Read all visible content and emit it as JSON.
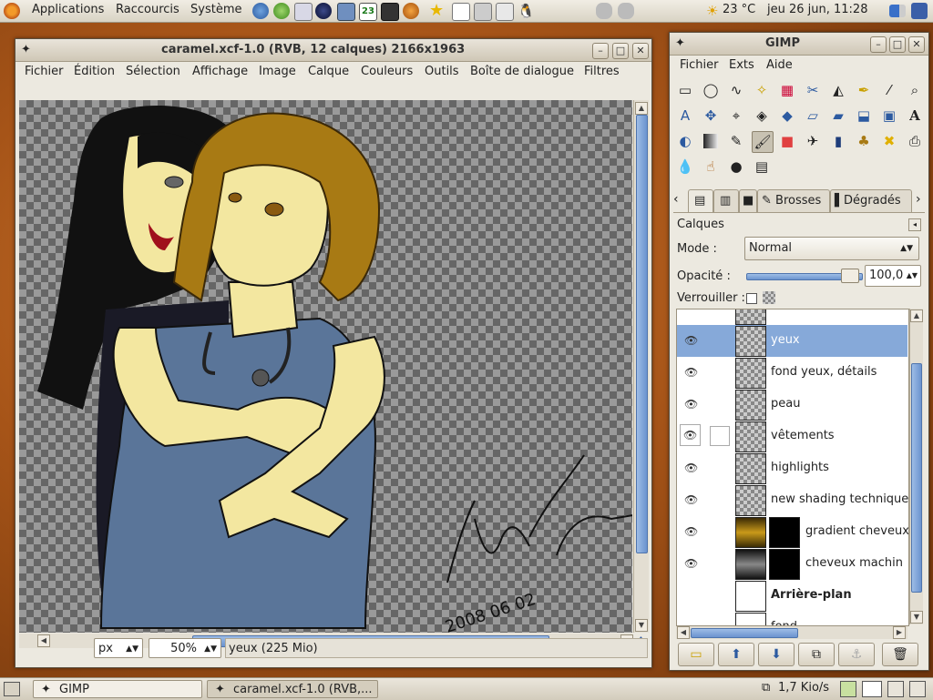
{
  "top_panel": {
    "menus": [
      "Applications",
      "Raccourcis",
      "Système"
    ],
    "weather": "23 °C",
    "clock": "jeu 26 jun, 11:28",
    "calendar_day": "23"
  },
  "image_window": {
    "title": "caramel.xcf-1.0 (RVB, 12 calques) 2166x1963",
    "menus": [
      "Fichier",
      "Édition",
      "Sélection",
      "Affichage",
      "Image",
      "Calque",
      "Couleurs",
      "Outils",
      "Boîte de dialogue",
      "Filtres"
    ],
    "unit": "px",
    "zoom": "50%",
    "status": "yeux (225 Mio)",
    "signature_date": "2008 06 02"
  },
  "toolbox": {
    "title": "GIMP",
    "menus": [
      "Fichier",
      "Exts",
      "Aide"
    ],
    "tabs": [
      "Brosses",
      "Dégradés"
    ],
    "layers_panel": {
      "header": "Calques",
      "mode_label": "Mode :",
      "mode_value": "Normal",
      "opacity_label": "Opacité :",
      "opacity_value": "100,0",
      "lock_label": "Verrouiller :",
      "layers": [
        {
          "name": "yeux",
          "selected": true,
          "visible": true
        },
        {
          "name": "fond yeux, détails",
          "visible": true
        },
        {
          "name": "peau",
          "visible": true
        },
        {
          "name": "vêtements",
          "visible": true
        },
        {
          "name": "highlights",
          "visible": true
        },
        {
          "name": "new shading technique:",
          "visible": true
        },
        {
          "name": "gradient cheveux",
          "visible": true
        },
        {
          "name": "cheveux machin",
          "visible": true
        },
        {
          "name": "Arrière-plan",
          "visible": false
        },
        {
          "name": "fond",
          "visible": false
        }
      ]
    }
  },
  "bottom_panel": {
    "tasks": [
      "GIMP",
      "caramel.xcf-1.0 (RVB,..."
    ],
    "network": "1,7 Kio/s"
  },
  "colors": {
    "selection": "#86a9d9",
    "skin": "#f3e7a0",
    "hair_brown": "#a87a14",
    "shirt_blue": "#5a7599"
  }
}
